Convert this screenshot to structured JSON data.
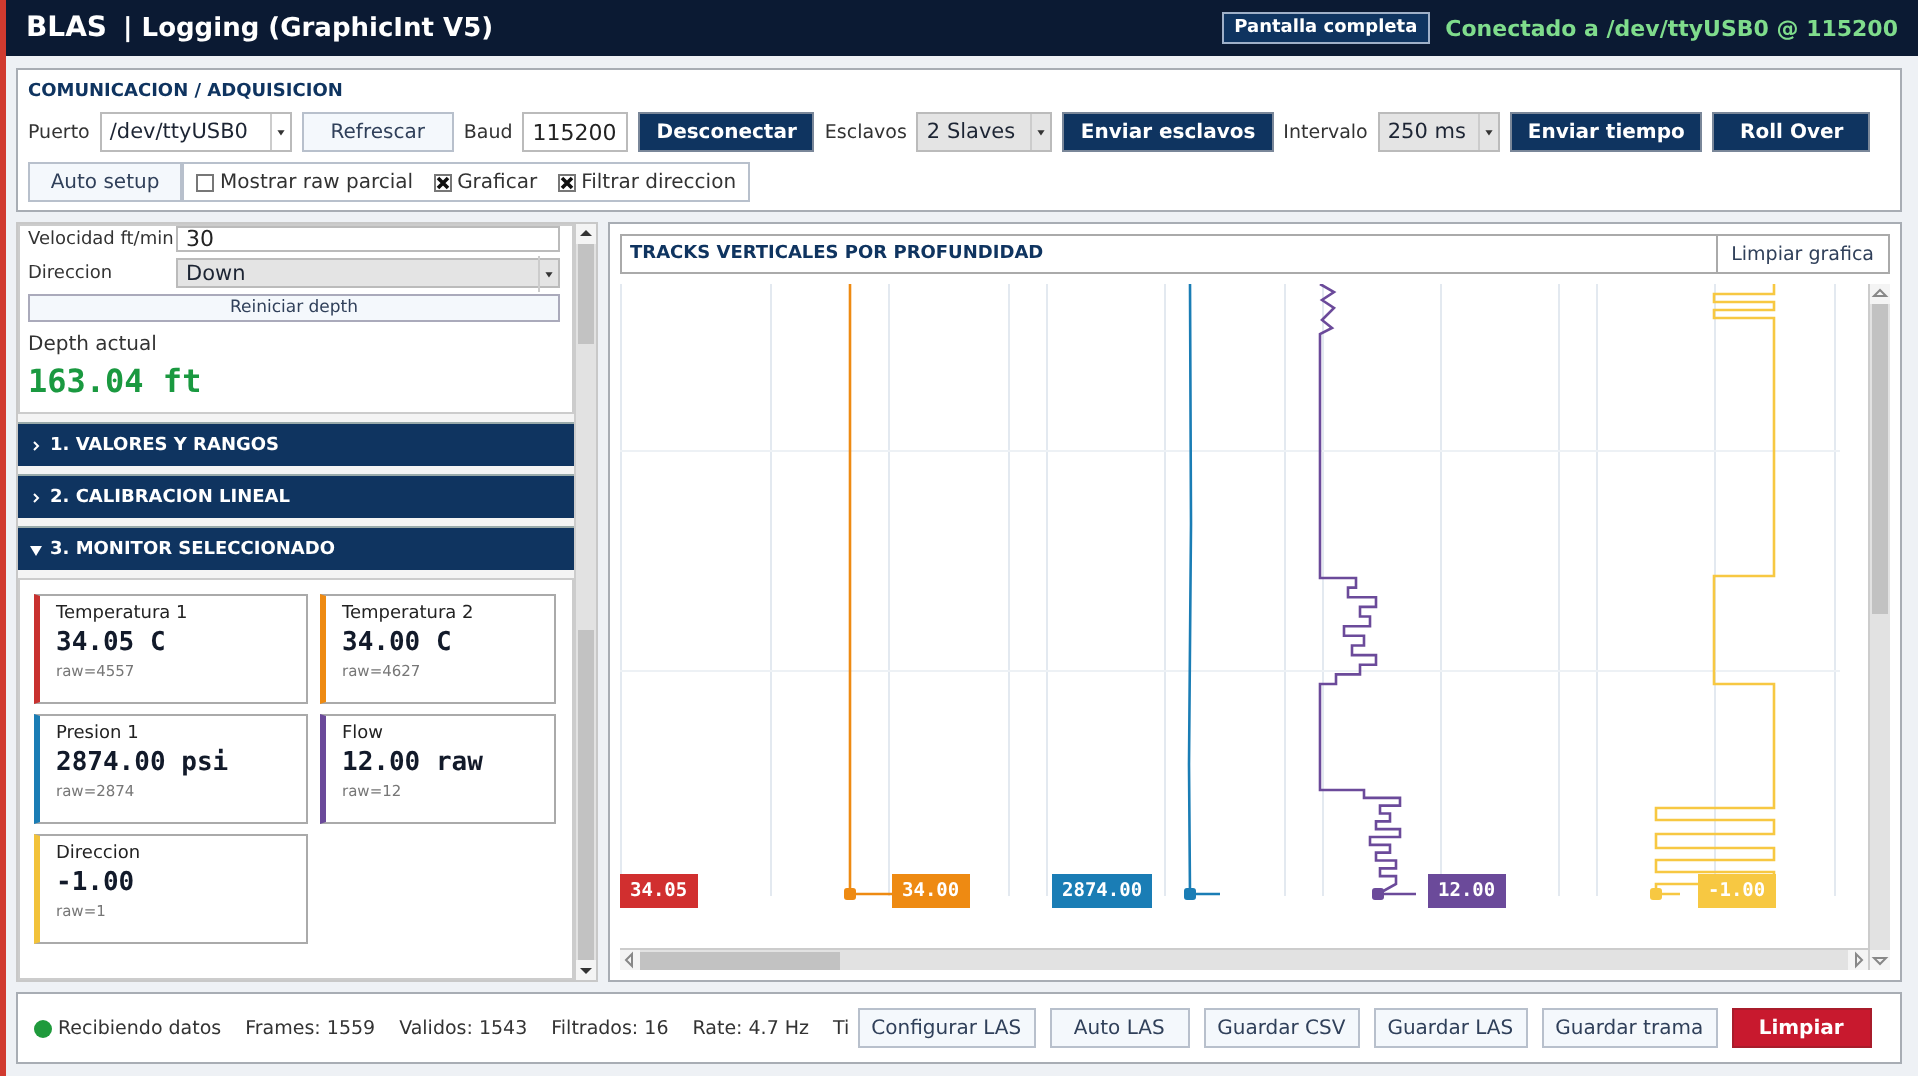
{
  "header": {
    "brand": "BLAS",
    "title": "| Logging (GraphicInt V5)",
    "fullscreen_button": "Pantalla completa",
    "connection": "Conectado a /dev/ttyUSB0 @ 115200"
  },
  "comm": {
    "title": "COMUNICACION / ADQUISICION",
    "port_label": "Puerto",
    "port": "/dev/ttyUSB0",
    "refresh_button": "Refrescar",
    "baud_label": "Baud",
    "baud": "115200",
    "disconnect_button": "Desconectar",
    "slaves_label": "Esclavos",
    "slaves": "2 Slaves",
    "send_slaves_button": "Enviar esclavos",
    "interval_label": "Intervalo",
    "interval": "250 ms",
    "send_time_button": "Enviar tiempo",
    "rollover_button": "Roll Over",
    "auto_setup_button": "Auto setup",
    "checks": [
      {
        "label": "Mostrar raw parcial",
        "checked": false
      },
      {
        "label": "Graficar",
        "checked": true
      },
      {
        "label": "Filtrar direccion",
        "checked": true
      }
    ]
  },
  "simulation": {
    "speed_label": "Velocidad ft/min",
    "speed": "30",
    "direction_label": "Direccion",
    "direction": "Down",
    "reset_button": "Reiniciar depth",
    "depth_label": "Depth actual",
    "depth": "163.04 ft"
  },
  "sections": [
    {
      "label": "1. VALORES Y RANGOS",
      "expanded": false
    },
    {
      "label": "2. CALIBRACION LINEAL",
      "expanded": false
    },
    {
      "label": "3. MONITOR SELECCIONADO",
      "expanded": true
    }
  ],
  "monitors": [
    {
      "name": "Temperatura 1",
      "value": "34.05 C",
      "raw": "raw=4557",
      "color": "#c8312f"
    },
    {
      "name": "Temperatura 2",
      "value": "34.00 C",
      "raw": "raw=4627",
      "color": "#ee8a12"
    },
    {
      "name": "Presion 1",
      "value": "2874.00 psi",
      "raw": "raw=2874",
      "color": "#1a7db5"
    },
    {
      "name": "Flow",
      "value": "12.00 raw",
      "raw": "raw=12",
      "color": "#6b4a9a"
    },
    {
      "name": "Direccion",
      "value": "-1.00",
      "raw": "raw=1",
      "color": "#f2c23a"
    }
  ],
  "chart": {
    "title": "TRACKS VERTICALES POR PROFUNDIDAD",
    "clear_button": "Limpiar grafica",
    "tracks": [
      {
        "value": "34.05",
        "color": "#d12f2f"
      },
      {
        "value": "34.00",
        "color": "#ee8a12"
      },
      {
        "value": "2874.00",
        "color": "#1a7db5"
      },
      {
        "value": "12.00",
        "color": "#6b4a9a"
      },
      {
        "value": "-1.00",
        "color": "#f7c842"
      }
    ]
  },
  "status": {
    "state": "Recibiendo datos",
    "receiving": true,
    "frames": "Frames: 1559",
    "valid": "Validos: 1543",
    "filtered": "Filtrados: 16",
    "rate": "Rate: 4.7 Hz",
    "cut_label": "Ti",
    "buttons": [
      {
        "label": "Configurar LAS",
        "kind": "normal"
      },
      {
        "label": "Auto LAS",
        "kind": "normal"
      },
      {
        "label": "Guardar CSV",
        "kind": "normal"
      },
      {
        "label": "Guardar LAS",
        "kind": "normal"
      },
      {
        "label": "Guardar trama",
        "kind": "normal"
      },
      {
        "label": "Limpiar",
        "kind": "danger"
      }
    ]
  }
}
